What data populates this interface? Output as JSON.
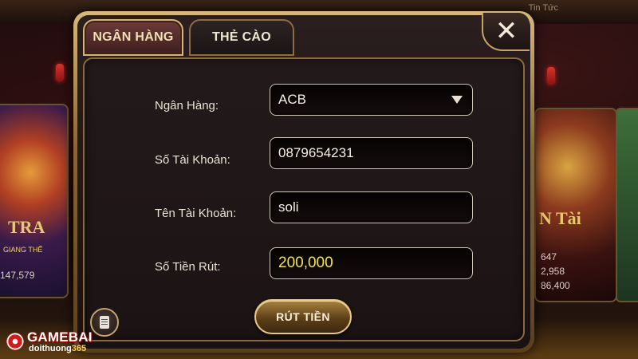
{
  "background": {
    "news_label": "Tin Tức",
    "left_game": {
      "title": "TRA",
      "subtitle": "GIANG THẾ",
      "jackpot": "147,579"
    },
    "right_game": {
      "title": "N Tài",
      "values": [
        "647",
        "2,958",
        "86,400"
      ]
    }
  },
  "dialog": {
    "tabs": [
      {
        "label": "NGÂN HÀNG",
        "active": true
      },
      {
        "label": "THẺ CÀO",
        "active": false
      }
    ],
    "close_icon": "close-x",
    "form": {
      "bank": {
        "label": "Ngân Hàng:",
        "value": "ACB"
      },
      "account_number": {
        "label": "Số Tài Khoản:",
        "value": "0879654231"
      },
      "account_name": {
        "label": "Tên Tài Khoản:",
        "value": "soli"
      },
      "amount": {
        "label": "Số Tiền Rút:",
        "value": "200,000"
      }
    },
    "submit_label": "RÚT TIỀN",
    "history_icon": "document-icon"
  },
  "watermark": {
    "brand": "GAMEBAI",
    "sub_prefix": "doithuong",
    "sub_number": "365"
  },
  "colors": {
    "gold_border": "#d6b478",
    "amount_text": "#f0e64a",
    "panel_bg": "#1c1314"
  }
}
